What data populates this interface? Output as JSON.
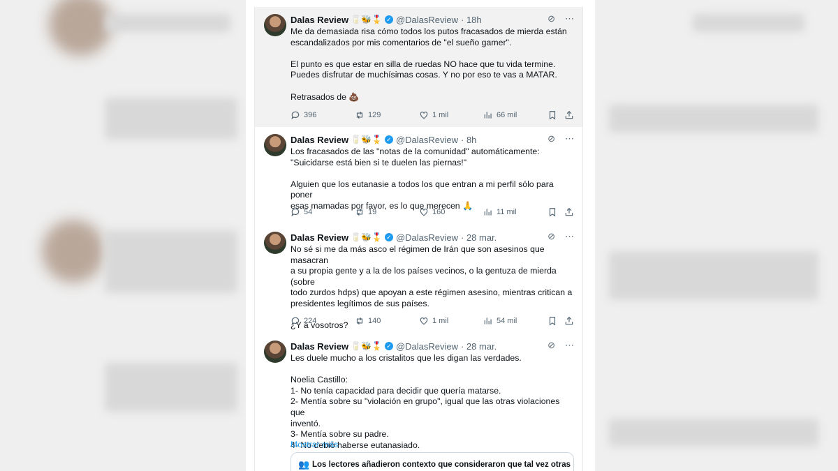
{
  "tweets": [
    {
      "name": "Dalas Review",
      "emojis": "🥛🐝🎖️",
      "handle": "@DalasReview",
      "time": "· 18h",
      "text": "Me da demasiada risa cómo todos los putos fracasados de mierda están\nescandalizados por mis comentarios de \"el sueño gamer\".\n\nEl punto es que estar en silla de ruedas NO hace que tu vida termine.\nPuedes disfrutar de muchísimas cosas. Y no por eso te vas a MATAR.\n\nRetrasados de 💩",
      "replies": "396",
      "retweets": "129",
      "likes": "1 mil",
      "views": "66 mil"
    },
    {
      "name": "Dalas Review",
      "emojis": "🥛🐝🎖️",
      "handle": "@DalasReview",
      "time": "· 8h",
      "text": "Los fracasados de las \"notas de la comunidad\" automáticamente:\n\"Suicidarse está bien si te duelen las piernas!\"\n\nAlguien que los eutanasie a todos los que entran a mi perfil sólo para poner\nesas mamadas por favor, es lo que merecen 🙏",
      "replies": "54",
      "retweets": "19",
      "likes": "160",
      "views": "11 mil"
    },
    {
      "name": "Dalas Review",
      "emojis": "🥛🐝🎖️",
      "handle": "@DalasReview",
      "time": "· 28 mar.",
      "text": "No sé si me da más asco el régimen de Irán que son asesinos que masacran\na su propia gente y a la de los países vecinos, o la gentuza de mierda (sobre\ntodo zurdos hdps) que apoyan a este régimen asesino, mientras critican a\npresidentes legítimos de sus países.\n\n¿Y a vosotros?",
      "replies": "224",
      "retweets": "140",
      "likes": "1 mil",
      "views": "54 mil"
    },
    {
      "name": "Dalas Review",
      "emojis": "🥛🐝🎖️",
      "handle": "@DalasReview",
      "time": "· 28 mar.",
      "text": "Les duele mucho a los cristalitos que les digan las verdades.\n\nNoelia Castillo:\n1- No tenía capacidad para decidir que quería matarse.\n2- Mentía sobre su \"violación en grupo\", igual que las otras violaciones que\ninventó.\n3- Mentía sobre su padre.\n4- No debió haberse eutanasiado.",
      "show_more": "Mostrar más",
      "notes_title": "Los lectores añadieron contexto que consideraron que tal vez otras"
    }
  ],
  "icons": {
    "grok": "grok-icon",
    "more": "more-icon",
    "reply": "reply-icon",
    "retweet": "retweet-icon",
    "like": "like-icon",
    "views": "views-icon",
    "bookmark": "bookmark-icon",
    "share": "share-icon"
  }
}
